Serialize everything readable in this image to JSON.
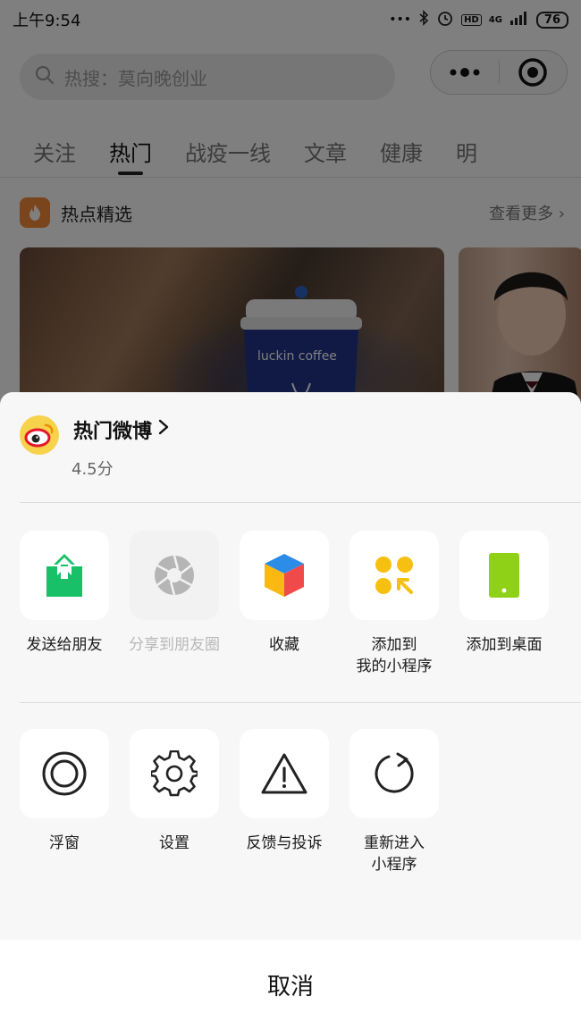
{
  "status_bar": {
    "time": "上午9:54",
    "dots": "•••",
    "network": "4G",
    "hd": "HD",
    "battery": "76"
  },
  "search": {
    "placeholder": "热搜：莫向晚创业"
  },
  "tabs": [
    {
      "label": "关注"
    },
    {
      "label": "热门"
    },
    {
      "label": "战疫一线"
    },
    {
      "label": "文章"
    },
    {
      "label": "健康"
    },
    {
      "label": "明"
    }
  ],
  "featured": {
    "title": "热点精选",
    "more": "查看更多 ›"
  },
  "card1": {
    "cup_text": "luckin coffee"
  },
  "sheet": {
    "app_name": "热门微博",
    "score": "4.5分",
    "row1": [
      {
        "label": "发送给朋友",
        "icon": "share-arrow-icon",
        "color": "#18c068"
      },
      {
        "label": "分享到朋友圈",
        "icon": "moments-shutter-icon",
        "color": "#b5b5b5",
        "disabled": true
      },
      {
        "label": "收藏",
        "icon": "favorites-cube-icon"
      },
      {
        "label": "添加到\n我的小程序",
        "icon": "add-miniprogram-icon",
        "color": "#f5c010"
      },
      {
        "label": "添加到桌面",
        "icon": "add-to-desktop-icon",
        "color": "#8fd116"
      }
    ],
    "row2": [
      {
        "label": "浮窗",
        "icon": "floating-window-icon"
      },
      {
        "label": "设置",
        "icon": "settings-gear-icon"
      },
      {
        "label": "反馈与投诉",
        "icon": "warning-triangle-icon"
      },
      {
        "label": "重新进入\n小程序",
        "icon": "reload-icon"
      }
    ],
    "cancel": "取消"
  }
}
